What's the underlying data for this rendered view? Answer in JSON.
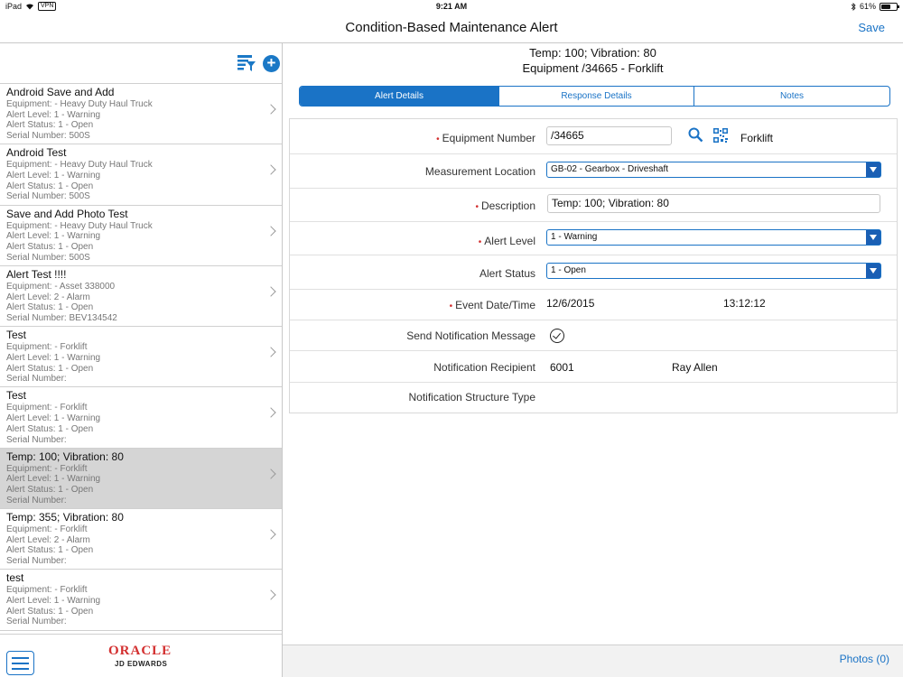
{
  "status_bar": {
    "device": "iPad",
    "vpn": "VPN",
    "time": "9:21 AM",
    "battery": "61%",
    "battery_fraction": 0.61
  },
  "header": {
    "title": "Condition-Based Maintenance Alert",
    "save_label": "Save"
  },
  "list": {
    "items": [
      {
        "name": "Android Save and Add",
        "equipment": "Equipment: - Heavy Duty Haul Truck",
        "level": "Alert Level: 1 - Warning",
        "status": "Alert Status: 1 - Open",
        "serial": "Serial Number: 500S",
        "selected": false
      },
      {
        "name": "Android Test",
        "equipment": "Equipment: - Heavy Duty Haul Truck",
        "level": "Alert Level: 1 - Warning",
        "status": "Alert Status: 1 - Open",
        "serial": "Serial Number: 500S",
        "selected": false
      },
      {
        "name": "Save and Add Photo Test",
        "equipment": "Equipment: - Heavy Duty Haul Truck",
        "level": "Alert Level: 1 - Warning",
        "status": "Alert Status: 1 - Open",
        "serial": "Serial Number: 500S",
        "selected": false
      },
      {
        "name": "Alert Test !!!!",
        "equipment": "Equipment: - Asset 338000",
        "level": "Alert Level: 2 - Alarm",
        "status": "Alert Status: 1 - Open",
        "serial": "Serial Number: BEV134542",
        "selected": false
      },
      {
        "name": "Test",
        "equipment": "Equipment: - Forklift",
        "level": "Alert Level: 1 - Warning",
        "status": "Alert Status: 1 - Open",
        "serial": "Serial Number:",
        "selected": false
      },
      {
        "name": "Test",
        "equipment": "Equipment: - Forklift",
        "level": "Alert Level: 1 - Warning",
        "status": "Alert Status: 1 - Open",
        "serial": "Serial Number:",
        "selected": false
      },
      {
        "name": "Temp: 100; Vibration: 80",
        "equipment": "Equipment: - Forklift",
        "level": "Alert Level: 1 - Warning",
        "status": "Alert Status: 1 - Open",
        "serial": "Serial Number:",
        "selected": true
      },
      {
        "name": "Temp: 355; Vibration: 80",
        "equipment": "Equipment: - Forklift",
        "level": "Alert Level: 2 - Alarm",
        "status": "Alert Status: 1 - Open",
        "serial": "Serial Number:",
        "selected": false
      },
      {
        "name": "test",
        "equipment": "Equipment: - Forklift",
        "level": "Alert Level: 1 - Warning",
        "status": "Alert Status: 1 - Open",
        "serial": "Serial Number:",
        "selected": false
      }
    ]
  },
  "branding": {
    "oracle": "ORACLE",
    "jde": "JD EDWARDS"
  },
  "detail": {
    "title_line1": "Temp: 100; Vibration: 80",
    "title_line2": "Equipment /34665 - Forklift",
    "tabs": [
      "Alert Details",
      "Response Details",
      "Notes"
    ],
    "active_tab": 0,
    "fields": {
      "equipment_number": {
        "label": "Equipment Number",
        "value": "/34665",
        "description": "Forklift"
      },
      "measurement_location": {
        "label": "Measurement Location",
        "value": "GB-02 - Gearbox - Driveshaft"
      },
      "description": {
        "label": "Description",
        "value": "Temp: 100; Vibration: 80"
      },
      "alert_level": {
        "label": "Alert Level",
        "value": "1 - Warning"
      },
      "alert_status": {
        "label": "Alert Status",
        "value": "1 - Open"
      },
      "event_datetime": {
        "label": "Event Date/Time",
        "date": "12/6/2015",
        "time": "13:12:12"
      },
      "send_notification": {
        "label": "Send Notification Message",
        "checked": true
      },
      "notification_recipient": {
        "label": "Notification Recipient",
        "value": "6001",
        "name": "Ray Allen"
      },
      "notification_structure": {
        "label": "Notification Structure Type",
        "value": ""
      }
    },
    "required_marker": "•"
  },
  "footer": {
    "photos_label": "Photos (0)"
  },
  "colors": {
    "accent": "#1a73c6",
    "required": "#d32f2f",
    "selected_row": "#d5d5d5"
  }
}
